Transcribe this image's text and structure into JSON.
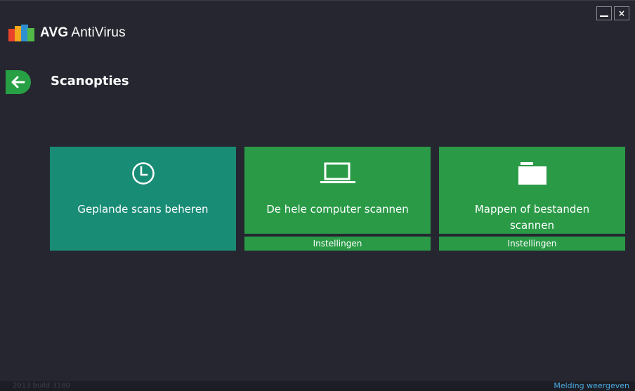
{
  "app": {
    "brand_bold": "AVG",
    "brand_rest": "AntiVirus"
  },
  "window_controls": {
    "close_label": "×"
  },
  "page": {
    "title": "Scanopties"
  },
  "tiles": [
    {
      "label": "Geplande scans beheren",
      "icon": "clock-icon",
      "color": "#198c76"
    },
    {
      "label": "De hele computer scannen",
      "icon": "laptop-icon",
      "color": "#2a9a47",
      "settings_label": "Instellingen"
    },
    {
      "label": "Mappen of bestanden scannen",
      "icon": "folder-icon",
      "color": "#2a9a47",
      "settings_label": "Instellingen"
    }
  ],
  "footer": {
    "build": "2013  build 3180",
    "notify_link": "Melding weergeven"
  },
  "colors": {
    "background": "#25262f",
    "accent_green": "#2a9a47",
    "accent_teal": "#198c76",
    "link_blue": "#4aa8e0"
  }
}
